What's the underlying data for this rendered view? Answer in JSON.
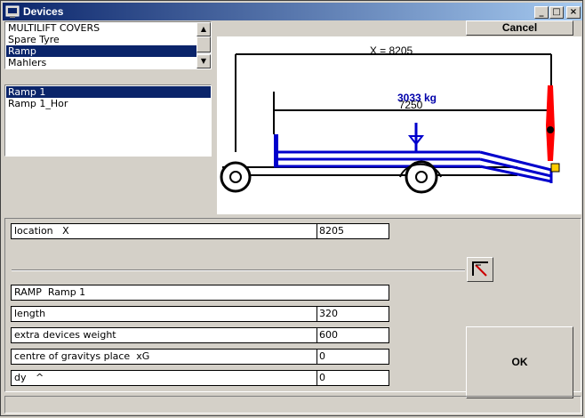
{
  "window": {
    "title": "Devices"
  },
  "title_buttons": {
    "minimize": "_",
    "maximize": "□",
    "close": "×"
  },
  "device_types": [
    {
      "label": "MULTILIFT COVERS",
      "selected": false
    },
    {
      "label": "Spare Tyre",
      "selected": false
    },
    {
      "label": "Ramp",
      "selected": true
    },
    {
      "label": "Mahlers",
      "selected": false
    }
  ],
  "device_items": [
    {
      "label": "Ramp 1",
      "selected": true
    },
    {
      "label": "Ramp 1_Hor",
      "selected": false
    }
  ],
  "buttons": {
    "cancel": "Cancel",
    "ok": "OK"
  },
  "drawing": {
    "overall_dimension": "X = 8205",
    "load_weight": "3033 kg",
    "inner_dimension": "7250",
    "colors": {
      "chassis": "#0000cc",
      "ramp": "#ff0000",
      "frame": "#000000",
      "text_blue": "#0000aa"
    }
  },
  "location": {
    "label": "location   X",
    "value": "8205"
  },
  "device_name": "RAMP  Ramp 1",
  "fields": [
    {
      "label": "length",
      "value": "320"
    },
    {
      "label": "extra devices weight",
      "value": "600"
    },
    {
      "label": "centre of gravitys place  xG",
      "value": "0"
    },
    {
      "label": "dy   ^",
      "value": "0"
    }
  ]
}
